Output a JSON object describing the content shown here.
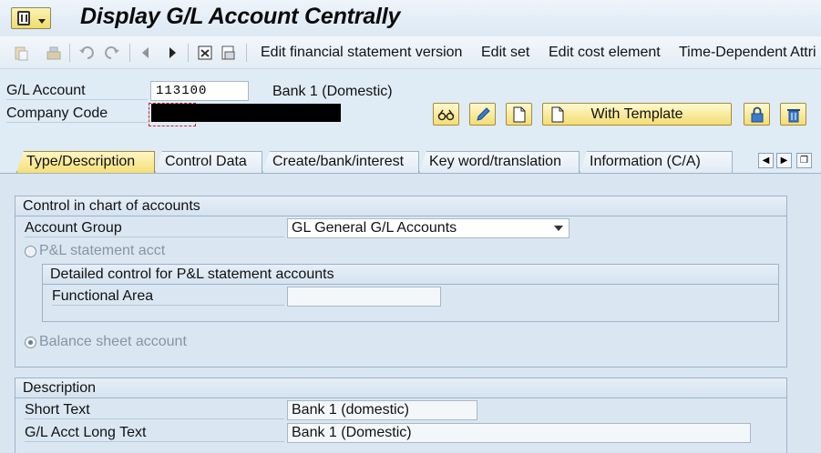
{
  "window": {
    "title": "Display G/L Account Centrally"
  },
  "toolbar": {
    "edit_fs_version": "Edit financial statement version",
    "edit_set": "Edit set",
    "edit_cost_element": "Edit cost element",
    "time_dependent": "Time-Dependent Attri"
  },
  "header": {
    "gl_account_label": "G/L Account",
    "gl_account_value": "113100",
    "gl_account_desc": "Bank 1 (Domestic)",
    "company_code_label": "Company Code",
    "with_template_label": "With Template"
  },
  "tabs": [
    {
      "label": "Type/Description",
      "active": true
    },
    {
      "label": "Control Data"
    },
    {
      "label": "Create/bank/interest"
    },
    {
      "label": "Key word/translation"
    },
    {
      "label": "Information (C/A)"
    }
  ],
  "control": {
    "title": "Control in chart of accounts",
    "account_group_label": "Account Group",
    "account_group_value": "GL General G/L Accounts",
    "pl_radio_label": "P&L statement acct",
    "detailed_title": "Detailed control for P&L statement accounts",
    "functional_area_label": "Functional Area",
    "functional_area_value": "",
    "bs_radio_label": "Balance sheet account"
  },
  "description": {
    "title": "Description",
    "short_text_label": "Short Text",
    "short_text_value": "Bank 1 (domestic)",
    "long_text_label": "G/L Acct Long Text",
    "long_text_value": "Bank 1 (Domestic)"
  },
  "colors": {
    "background": "#dfebf5",
    "button_yellow": "#f4dd72",
    "border": "#9fb2c6"
  }
}
